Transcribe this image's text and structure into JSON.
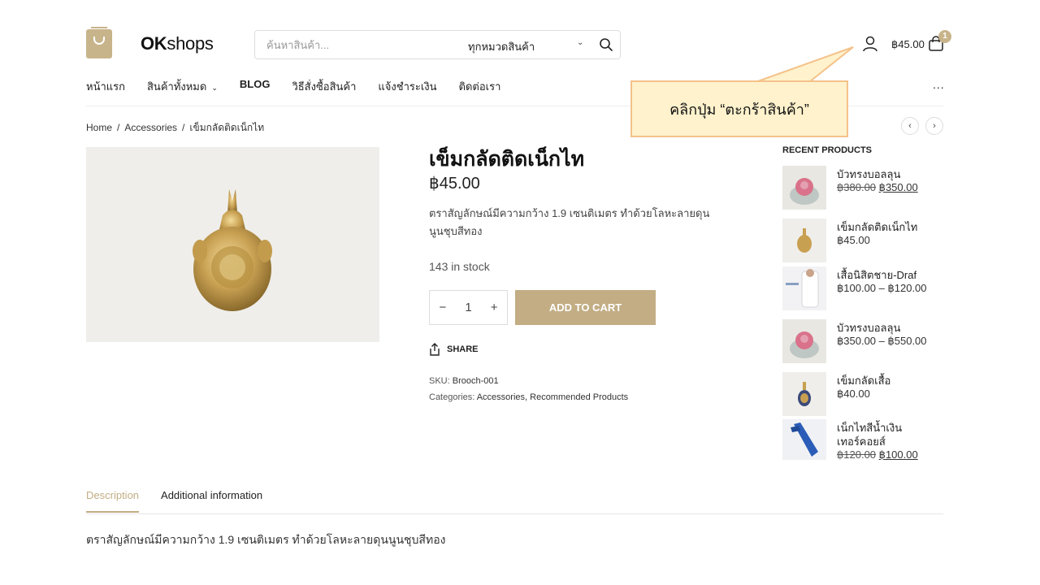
{
  "header": {
    "logo_ok": "OK",
    "logo_shops": "shops",
    "search_placeholder": "ค้นหาสินค้า...",
    "search_category": "ทุกหมวดสินค้า",
    "cart_total": "฿45.00",
    "cart_count": "1"
  },
  "nav": {
    "items": [
      "หน้าแรก",
      "สินค้าทั้งหมด",
      "BLOG",
      "วิธีสั่งซื้อสินค้า",
      "แจ้งชำระเงิน",
      "ติดต่อเรา"
    ],
    "more": "..."
  },
  "breadcrumb": {
    "home": "Home",
    "category": "Accessories",
    "current": "เข็มกลัดติดเน็กไท"
  },
  "product": {
    "title": "เข็มกลัดติดเน็กไท",
    "price": "฿45.00",
    "short_description": "ตราสัญลักษณ์มีความกว้าง 1.9 เซนติเมตร ทำด้วยโลหะลายดุนนูนชุบสีทอง",
    "stock": "143 in stock",
    "quantity": "1",
    "add_to_cart": "ADD TO CART",
    "share": "SHARE",
    "sku_label": "SKU:",
    "sku": "Brooch-001",
    "categories_label": "Categories:",
    "categories": "Accessories, Recommended Products"
  },
  "recent": {
    "title": "RECENT PRODUCTS",
    "items": [
      {
        "name": "บัวทรงบอลลุน",
        "name2": "",
        "old_price": "฿380.00",
        "price": "฿350.00"
      },
      {
        "name": "เข็มกลัดติดเน็กไท",
        "name2": "",
        "old_price": "",
        "price": "฿45.00"
      },
      {
        "name": "เสื้อนิสิตชาย-Draf",
        "name2": "",
        "old_price": "",
        "price": "฿100.00 – ฿120.00"
      },
      {
        "name": "บัวทรงบอลลุน",
        "name2": "",
        "old_price": "",
        "price": "฿350.00 – ฿550.00"
      },
      {
        "name": "เข็มกลัดเสื้อ",
        "name2": "",
        "old_price": "",
        "price": "฿40.00"
      },
      {
        "name": "เน็กไทสีน้ำเงิน",
        "name2": "เทอร์คอยส์",
        "old_price": "฿120.00",
        "price": "฿100.00"
      }
    ]
  },
  "tabs": {
    "description": "Description",
    "additional": "Additional information",
    "body": "ตราสัญลักษณ์มีความกว้าง 1.9 เซนติเมตร ทำด้วยโลหะลายดุนนูนชุบสีทอง"
  },
  "callout": {
    "text": "คลิกปุ่ม “ตะกร้าสินค้า”"
  },
  "colors": {
    "accent": "#c2ad84",
    "callout_bg": "#fff2cc",
    "callout_border": "#f4c28a"
  }
}
